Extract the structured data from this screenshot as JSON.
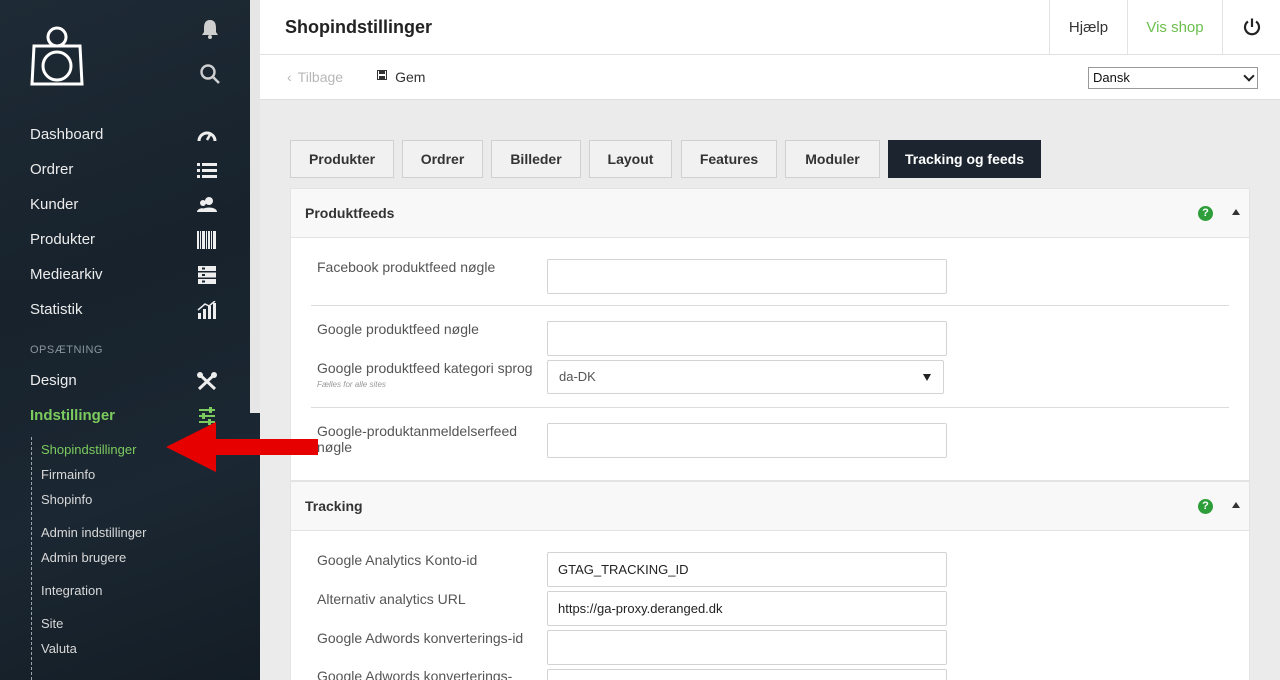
{
  "sidebar": {
    "nav": [
      {
        "label": "Dashboard",
        "icon": "speedometer-icon"
      },
      {
        "label": "Ordrer",
        "icon": "list-icon"
      },
      {
        "label": "Kunder",
        "icon": "users-icon"
      },
      {
        "label": "Produkter",
        "icon": "barcode-icon"
      },
      {
        "label": "Mediearkiv",
        "icon": "media-icon"
      },
      {
        "label": "Statistik",
        "icon": "chart-icon"
      }
    ],
    "section_label": "OPSÆTNING",
    "setup": [
      {
        "label": "Design",
        "icon": "tools-icon"
      },
      {
        "label": "Indstillinger",
        "icon": "sliders-icon"
      }
    ],
    "sub_items": [
      "Shopindstillinger",
      "Firmainfo",
      "Shopinfo",
      "Admin indstillinger",
      "Admin brugere",
      "Integration",
      "Site",
      "Valuta"
    ]
  },
  "header": {
    "title": "Shopindstillinger",
    "help": "Hjælp",
    "view_shop": "Vis shop"
  },
  "subbar": {
    "back": "Tilbage",
    "save": "Gem",
    "language": "Dansk"
  },
  "tabs": [
    "Produkter",
    "Ordrer",
    "Billeder",
    "Layout",
    "Features",
    "Moduler",
    "Tracking og feeds"
  ],
  "feeds_panel": {
    "title": "Produktfeeds",
    "facebook_label": "Facebook produktfeed nøgle",
    "facebook_value": "",
    "google_label": "Google produktfeed nøgle",
    "google_value": "",
    "google_lang_label": "Google produktfeed kategori sprog",
    "google_lang_hint": "Fælles for alle sites",
    "google_lang_value": "da-DK",
    "review_label": "Google-produktanmeldelserfeed nøgle",
    "review_value": ""
  },
  "tracking_panel": {
    "title": "Tracking",
    "ga_label": "Google Analytics Konto-id",
    "ga_value": "GTAG_TRACKING_ID",
    "alt_label": "Alternativ analytics URL",
    "alt_value": "https://ga-proxy.deranged.dk",
    "adwords_label": "Google Adwords konverterings-id",
    "adwords_value": "",
    "adwords2_label": "Google Adwords konverterings-",
    "adwords2_value": ""
  },
  "colors": {
    "accent_green": "#7ccb5e",
    "sidebar_bg": "#1b2631",
    "annotation_arrow": "#e60000"
  }
}
